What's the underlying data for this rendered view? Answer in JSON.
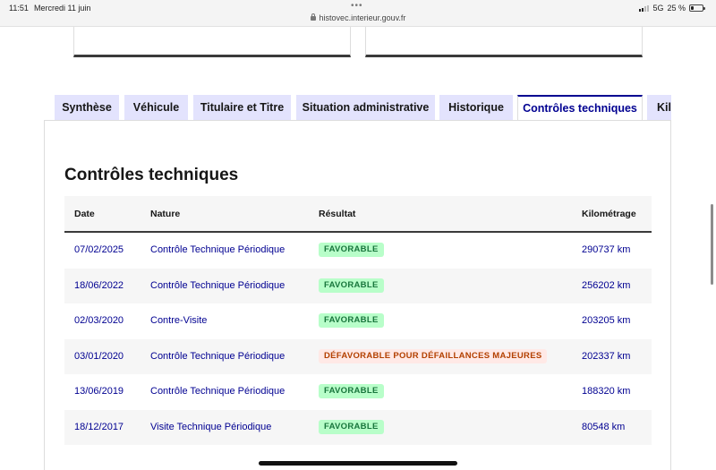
{
  "status_bar": {
    "time": "11:51",
    "date": "Mercredi 11 juin",
    "dots": "•••",
    "url": "histovec.interieur.gouv.fr",
    "network": "5G",
    "battery": "25 %",
    "battery_level": 0.25
  },
  "tabs": [
    {
      "label": "Synthèse",
      "active": false
    },
    {
      "label": "Véhicule",
      "active": false
    },
    {
      "label": "Titulaire et Titre",
      "active": false
    },
    {
      "label": "Situation administrative",
      "active": false
    },
    {
      "label": "Historique",
      "active": false
    },
    {
      "label": "Contrôles techniques",
      "active": true
    },
    {
      "label": "Kilométrage",
      "active": false
    }
  ],
  "section": {
    "title": "Contrôles techniques"
  },
  "table": {
    "headers": {
      "date": "Date",
      "nature": "Nature",
      "result": "Résultat",
      "km": "Kilométrage"
    },
    "rows": [
      {
        "date": "07/02/2025",
        "nature": "Contrôle Technique Périodique",
        "result": "FAVORABLE",
        "status": "ok",
        "km": "290737 km"
      },
      {
        "date": "18/06/2022",
        "nature": "Contrôle Technique Périodique",
        "result": "FAVORABLE",
        "status": "ok",
        "km": "256202 km"
      },
      {
        "date": "02/03/2020",
        "nature": "Contre-Visite",
        "result": "FAVORABLE",
        "status": "ok",
        "km": "203205 km"
      },
      {
        "date": "03/01/2020",
        "nature": "Contrôle Technique Périodique",
        "result": "DÉFAVORABLE POUR DÉFAILLANCES MAJEURES",
        "status": "ko",
        "km": "202337 km"
      },
      {
        "date": "13/06/2019",
        "nature": "Contrôle Technique Périodique",
        "result": "FAVORABLE",
        "status": "ok",
        "km": "188320 km"
      },
      {
        "date": "18/12/2017",
        "nature": "Visite Technique Périodique",
        "result": "FAVORABLE",
        "status": "ok",
        "km": "80548 km"
      }
    ]
  },
  "colors": {
    "accent": "#000091",
    "tab_background": "#e3e3fd",
    "favorable_bg": "#b8fec9",
    "favorable_text": "#18753c",
    "defavorable_bg": "#ffe9e6",
    "defavorable_text": "#b34000"
  }
}
